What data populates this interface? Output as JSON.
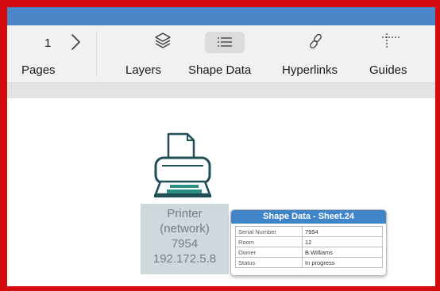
{
  "toolbar": {
    "page_number": "1",
    "pages_label": "Pages",
    "layers_label": "Layers",
    "shape_data_label": "Shape Data",
    "hyperlinks_label": "Hyperlinks",
    "guides_label": "Guides"
  },
  "shape": {
    "lines": [
      "Printer",
      "(network)",
      "7954",
      "192.172.5.8"
    ]
  },
  "shape_data_popup": {
    "title": "Shape Data - Sheet.24",
    "rows": [
      {
        "key": "Serial Number",
        "value": "7954"
      },
      {
        "key": "Room",
        "value": "12"
      },
      {
        "key": "Owner",
        "value": "B.Williams"
      },
      {
        "key": "Status",
        "value": "In progress"
      }
    ]
  },
  "colors": {
    "frame_border": "#d40c10",
    "titlebar": "#4a86c8",
    "popup_header": "#3f85c8",
    "shape_fill": "#cfd9dd",
    "shape_text": "#6e7f86"
  },
  "icons": {
    "next_page": "chevron-right-icon",
    "layers": "layers-icon",
    "shape_data": "list-icon",
    "hyperlinks": "link-icon",
    "guides": "guides-icon",
    "shape": "printer-icon"
  }
}
